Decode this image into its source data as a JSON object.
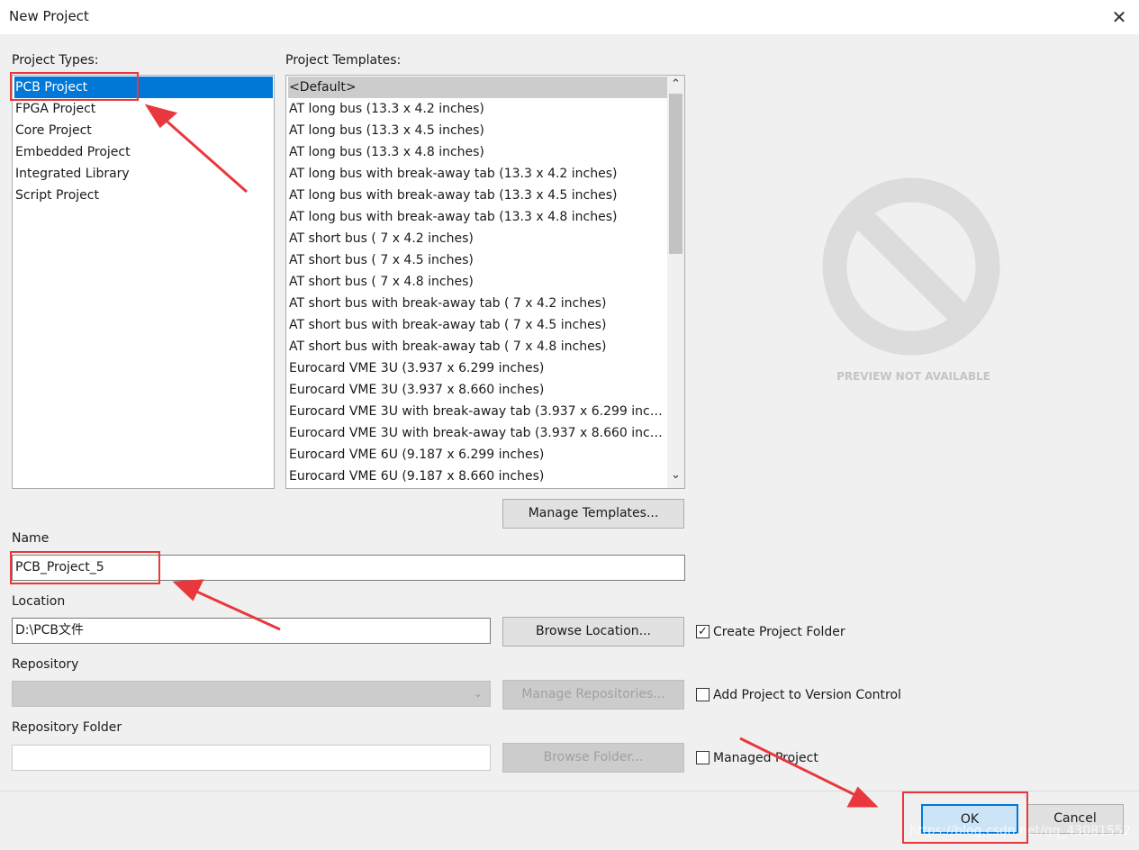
{
  "window": {
    "title": "New Project",
    "close_glyph": "✕"
  },
  "project_types": {
    "label": "Project Types:",
    "items": [
      "PCB Project",
      "FPGA Project",
      "Core Project",
      "Embedded Project",
      "Integrated Library",
      "Script Project"
    ],
    "selected": "PCB Project"
  },
  "project_templates": {
    "label": "Project Templates:",
    "items": [
      "<Default>",
      "AT long bus (13.3 x 4.2 inches)",
      "AT long bus (13.3 x 4.5 inches)",
      "AT long bus (13.3 x 4.8 inches)",
      "AT long bus with break-away tab (13.3 x 4.2 inches)",
      "AT long bus with break-away tab (13.3 x 4.5 inches)",
      "AT long bus with break-away tab (13.3 x 4.8 inches)",
      "AT short bus ( 7 x 4.2 inches)",
      "AT short bus ( 7 x 4.5 inches)",
      "AT short bus ( 7 x 4.8 inches)",
      "AT short bus with break-away tab ( 7 x 4.2 inches)",
      "AT short bus with break-away tab ( 7 x 4.5 inches)",
      "AT short bus with break-away tab ( 7 x 4.8 inches)",
      "Eurocard VME 3U (3.937 x 6.299 inches)",
      "Eurocard VME 3U (3.937 x 8.660 inches)",
      "Eurocard VME 3U with break-away tab (3.937 x 6.299 inch...",
      "Eurocard VME 3U with break-away tab (3.937 x 8.660 inch...",
      "Eurocard VME 6U (9.187 x 6.299 inches)",
      "Eurocard VME 6U (9.187 x 8.660 inches)"
    ],
    "selected": "<Default>",
    "scroll_up_glyph": "⌃",
    "scroll_down_glyph": "⌄"
  },
  "preview": {
    "text": "PREVIEW NOT AVAILABLE",
    "icon": "no-preview-icon"
  },
  "manage_templates_button": "Manage Templates...",
  "name": {
    "label": "Name",
    "value": "PCB_Project_5"
  },
  "location": {
    "label": "Location",
    "value": "D:\\PCB文件",
    "browse_button": "Browse Location..."
  },
  "create_project_folder": {
    "label": "Create Project Folder",
    "checked": true,
    "check_glyph": "✓"
  },
  "repository": {
    "label": "Repository",
    "value": "",
    "dropdown_glyph": "⌄",
    "manage_button": "Manage Repositories..."
  },
  "add_to_version_control": {
    "label": "Add Project to Version Control",
    "checked": false
  },
  "repository_folder": {
    "label": "Repository Folder",
    "value": "",
    "browse_button": "Browse Folder..."
  },
  "managed_project": {
    "label": "Managed Project",
    "checked": false
  },
  "footer": {
    "ok_button": "OK",
    "cancel_button": "Cancel",
    "watermark": "https://blog.csdn.net/qq_43081552"
  },
  "colors": {
    "selection": "#0078d7",
    "annotation": "#e8383d",
    "dialog_bg": "#f0f0f0"
  }
}
